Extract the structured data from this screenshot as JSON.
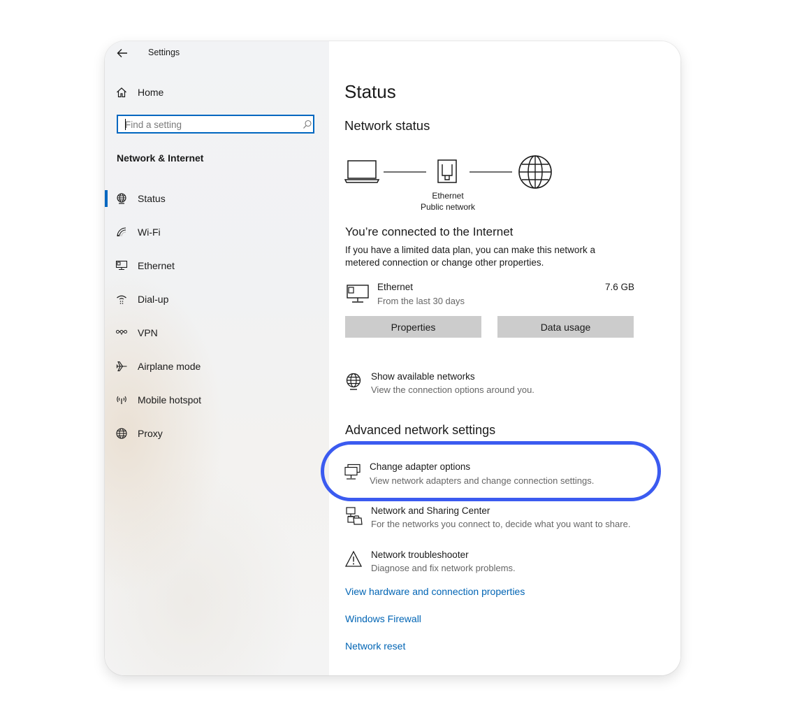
{
  "window": {
    "title": "Settings"
  },
  "sidebar": {
    "home_label": "Home",
    "search_placeholder": "Find a setting",
    "section_heading": "Network & Internet",
    "items": [
      {
        "label": "Status",
        "icon": "globe-status-icon",
        "selected": true
      },
      {
        "label": "Wi-Fi",
        "icon": "wifi-icon"
      },
      {
        "label": "Ethernet",
        "icon": "ethernet-icon"
      },
      {
        "label": "Dial-up",
        "icon": "dialup-icon"
      },
      {
        "label": "VPN",
        "icon": "vpn-icon"
      },
      {
        "label": "Airplane mode",
        "icon": "airplane-icon"
      },
      {
        "label": "Mobile hotspot",
        "icon": "hotspot-icon"
      },
      {
        "label": "Proxy",
        "icon": "globe-icon"
      }
    ]
  },
  "main": {
    "title": "Status",
    "network_status_heading": "Network status",
    "diagram": {
      "adapter_name": "Ethernet",
      "network_type": "Public network"
    },
    "connected_heading": "You’re connected to the Internet",
    "connected_desc_line1": "If you have a limited data plan, you can make this network a",
    "connected_desc_line2": "metered connection or change other properties.",
    "usage": {
      "name": "Ethernet",
      "period": "From the last 30 days",
      "amount": "7.6 GB"
    },
    "buttons": {
      "properties": "Properties",
      "data_usage": "Data usage"
    },
    "show_networks": {
      "title": "Show available networks",
      "desc": "View the connection options around you."
    },
    "advanced_heading": "Advanced network settings",
    "advanced_items": [
      {
        "title": "Change adapter options",
        "desc": "View network adapters and change connection settings."
      },
      {
        "title": "Network and Sharing Center",
        "desc": "For the networks you connect to, decide what you want to share."
      },
      {
        "title": "Network troubleshooter",
        "desc": "Diagnose and fix network problems."
      }
    ],
    "links": [
      "View hardware and connection properties",
      "Windows Firewall",
      "Network reset"
    ]
  },
  "colors": {
    "accent": "#0067c0",
    "link": "#0064b4",
    "highlight": "#3b5bf0",
    "button": "#cccccc"
  }
}
